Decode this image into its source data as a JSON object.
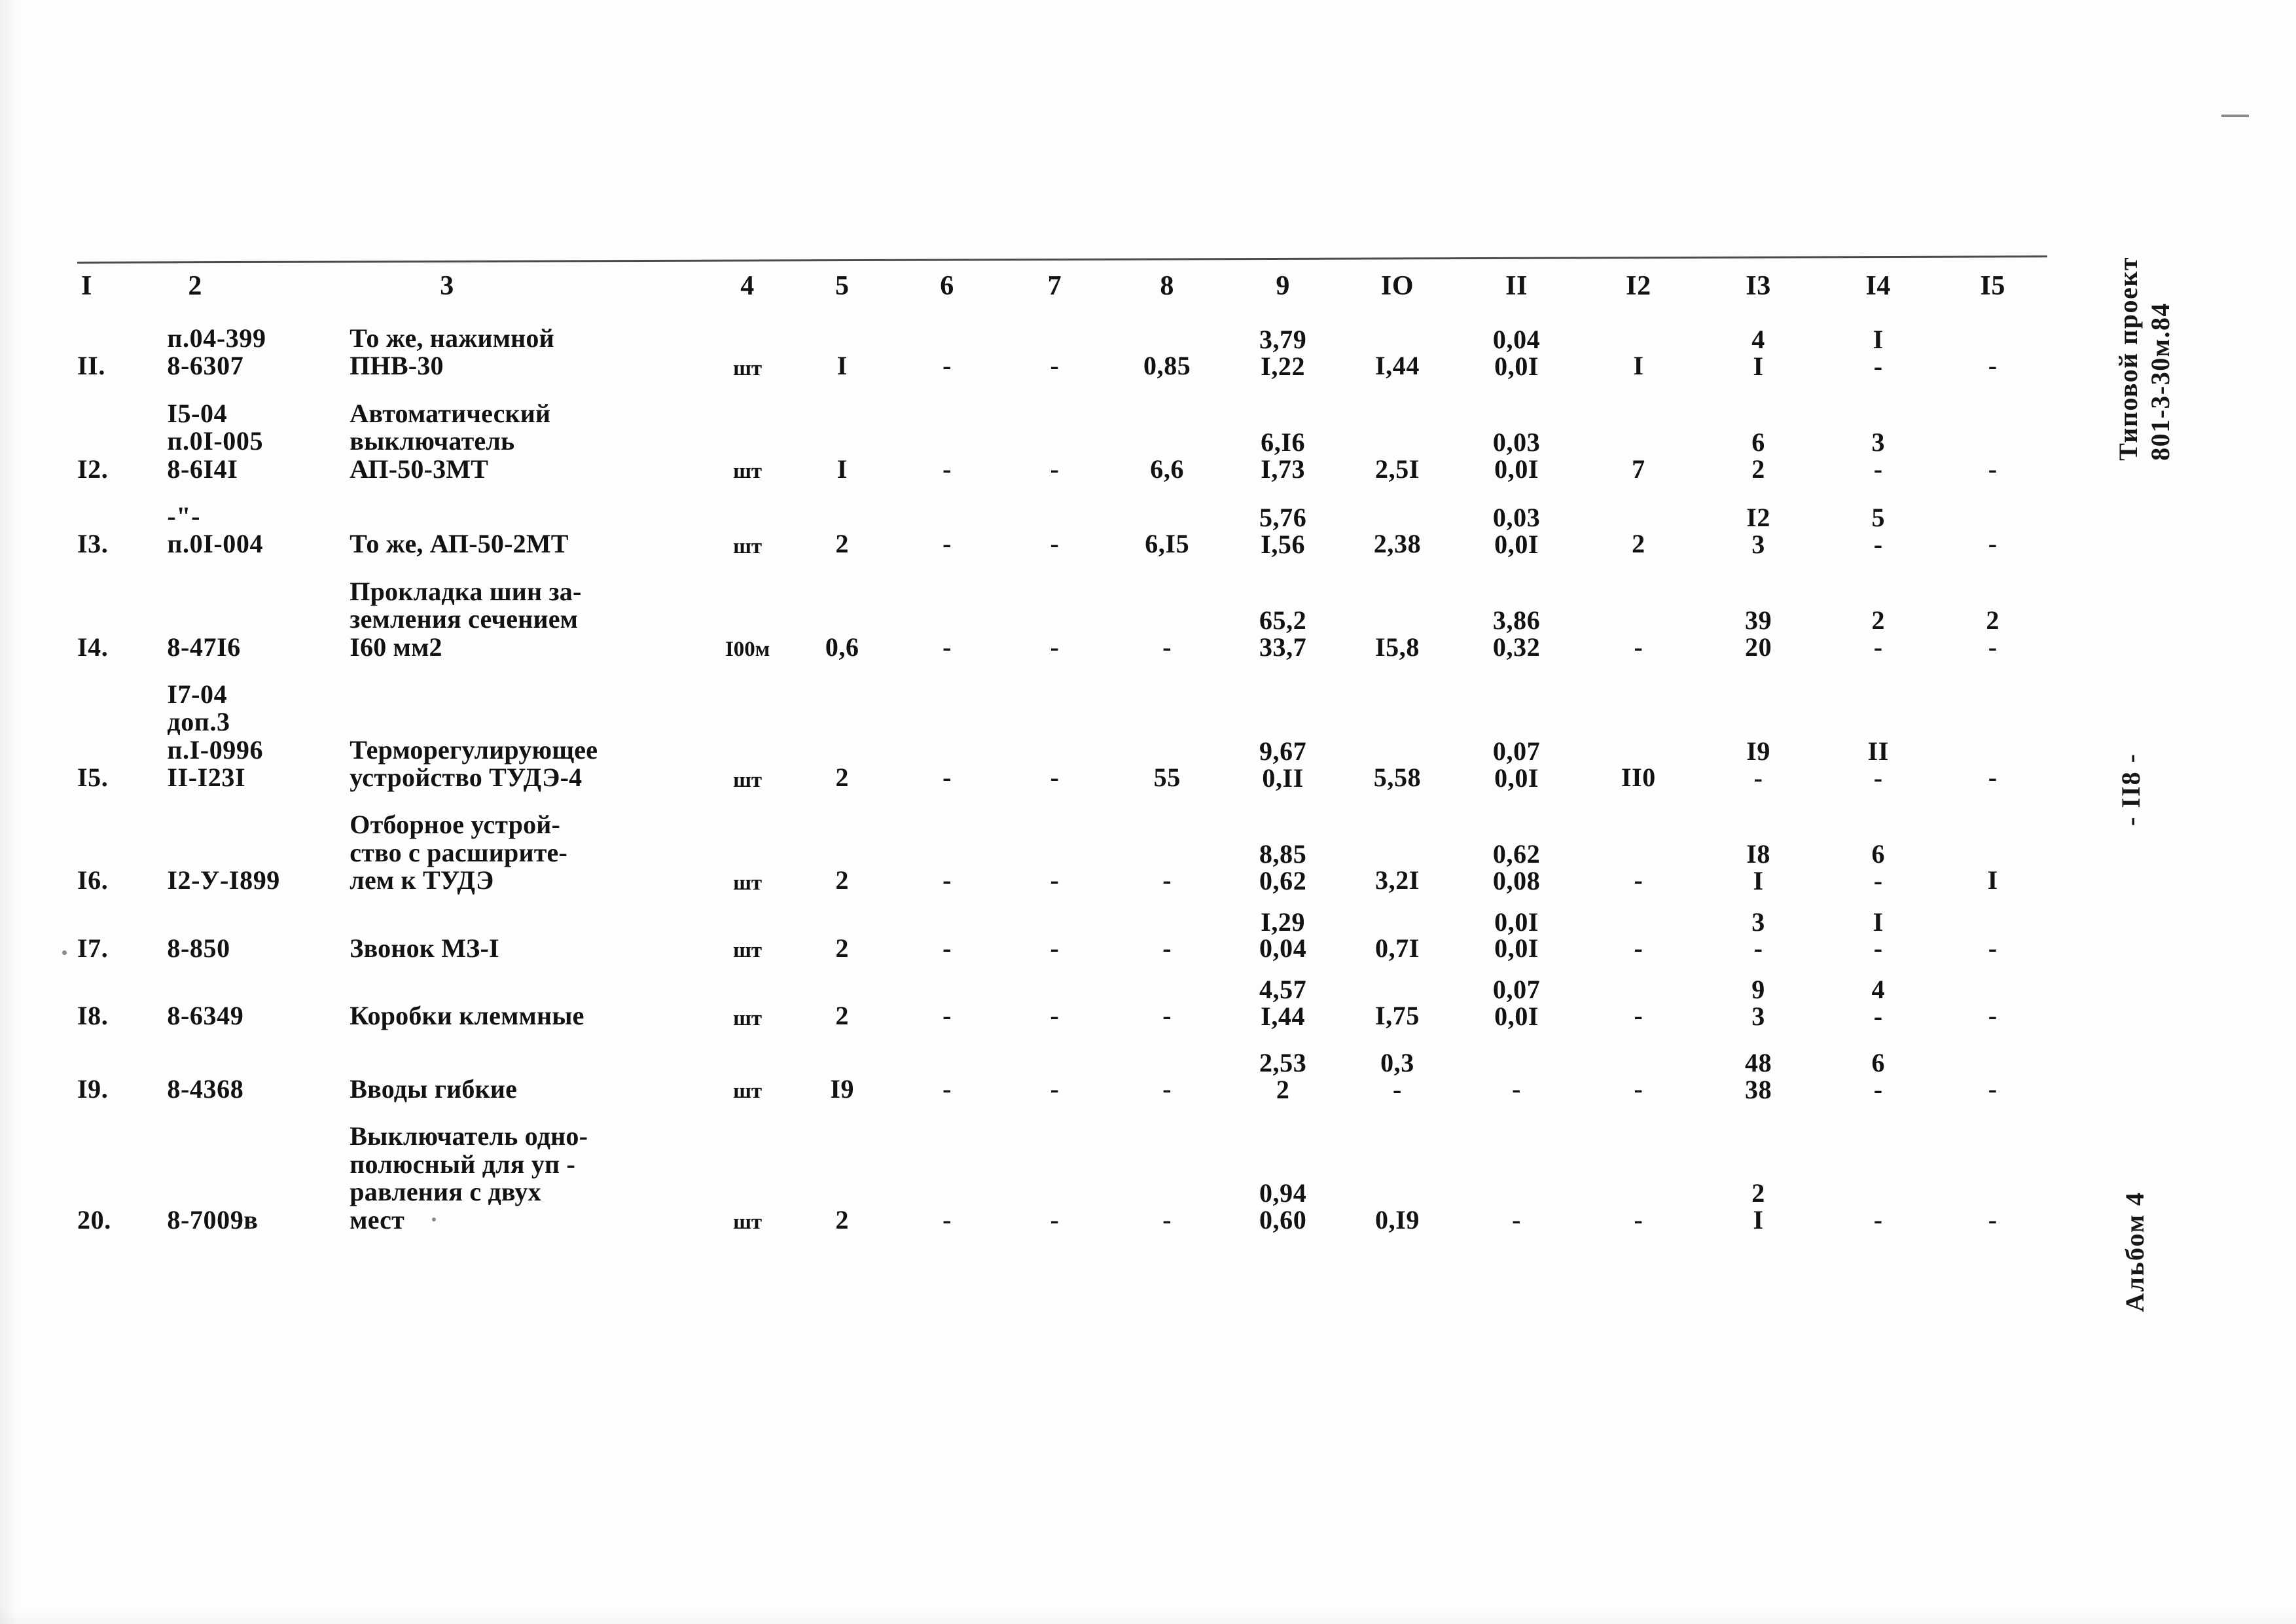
{
  "document": {
    "project_stamp": "Типовой проект\n801-3-30м.84",
    "page_number": "- II8 -",
    "album_label": "Альбом 4"
  },
  "table": {
    "column_headers": [
      "I",
      "2",
      "3",
      "4",
      "5",
      "6",
      "7",
      "8",
      "9",
      "IO",
      "II",
      "I2",
      "I3",
      "I4",
      "I5"
    ],
    "rows": [
      {
        "no": "II.",
        "code": "п.04-399\n8-6307",
        "name": "То же, нажимной\nПНВ-30",
        "unit": "шт",
        "qty": "I",
        "c6": "-",
        "c7": "-",
        "c8": "0,85",
        "c9_top": "3,79",
        "c9_bot": "I,22",
        "c10": "I,44",
        "c11_top": "0,04",
        "c11_bot": "0,0I",
        "c12": "I",
        "c13_top": "4",
        "c13_bot": "I",
        "c14_top": "I",
        "c14_bot": "-",
        "c15": "-"
      },
      {
        "no": "I2.",
        "code": "I5-04\nп.0I-005\n8-6I4I",
        "name": "Автоматический\nвыключатель\nАП-50-3МТ",
        "unit": "шт",
        "qty": "I",
        "c6": "-",
        "c7": "-",
        "c8": "6,6",
        "c9_top": "6,I6",
        "c9_bot": "I,73",
        "c10": "2,5I",
        "c11_top": "0,03",
        "c11_bot": "0,0I",
        "c12": "7",
        "c13_top": "6",
        "c13_bot": "2",
        "c14_top": "3",
        "c14_bot": "-",
        "c15": "-"
      },
      {
        "no": "I3.",
        "code": "-\"-\nп.0I-004",
        "name": "То же, АП-50-2МТ",
        "unit": "шт",
        "qty": "2",
        "c6": "-",
        "c7": "-",
        "c8": "6,I5",
        "c9_top": "5,76",
        "c9_bot": "I,56",
        "c10": "2,38",
        "c11_top": "0,03",
        "c11_bot": "0,0I",
        "c12": "2",
        "c13_top": "I2",
        "c13_bot": "3",
        "c14_top": "5",
        "c14_bot": "-",
        "c15": "-"
      },
      {
        "no": "I4.",
        "code": "8-47I6",
        "name": "Прокладка шин за-\nземления сечением\nI60 мм2",
        "unit": "I00м",
        "qty": "0,6",
        "c6": "-",
        "c7": "-",
        "c8": "-",
        "c9_top": "65,2",
        "c9_bot": "33,7",
        "c10": "I5,8",
        "c11_top": "3,86",
        "c11_bot": "0,32",
        "c12": "-",
        "c13_top": "39",
        "c13_bot": "20",
        "c14_top": "2",
        "c14_bot": "-",
        "c15_top": "2",
        "c15_bot": "-"
      },
      {
        "no": "I5.",
        "code": "I7-04\nдоп.3\nп.I-0996\nII-I23I",
        "name": "Терморегулирующее\nустройство ТУДЭ-4",
        "unit": "шт",
        "qty": "2",
        "c6": "-",
        "c7": "-",
        "c8": "55",
        "c9_top": "9,67",
        "c9_bot": "0,II",
        "c10": "5,58",
        "c11_top": "0,07",
        "c11_bot": "0,0I",
        "c12": "II0",
        "c13_top": "I9",
        "c13_bot": "-",
        "c14_top": "II",
        "c14_bot": "-",
        "c15": "-"
      },
      {
        "no": "I6.",
        "code": "I2-У-I899",
        "name": "Отборное устрой-\nство с расширите-\nлем к ТУДЭ",
        "unit": "шт",
        "qty": "2",
        "c6": "-",
        "c7": "-",
        "c8": "-",
        "c9_top": "8,85",
        "c9_bot": "0,62",
        "c10": "3,2I",
        "c11_top": "0,62",
        "c11_bot": "0,08",
        "c12": "-",
        "c13_top": "I8",
        "c13_bot": "I",
        "c14_top": "6",
        "c14_bot": "-",
        "c15": "I"
      },
      {
        "no": "I7.",
        "code": "8-850",
        "name": "Звонок МЗ-I",
        "unit": "шт",
        "qty": "2",
        "c6": "-",
        "c7": "-",
        "c8": "-",
        "c9_top": "I,29",
        "c9_bot": "0,04",
        "c10": "0,7I",
        "c11_top": "0,0I",
        "c11_bot": "0,0I",
        "c12": "-",
        "c13_top": "3",
        "c13_bot": "-",
        "c14_top": "I",
        "c14_bot": "-",
        "c15": "-"
      },
      {
        "no": "I8.",
        "code": "8-6349",
        "name": "Коробки клеммные",
        "unit": "шт",
        "qty": "2",
        "c6": "-",
        "c7": "-",
        "c8": "-",
        "c9_top": "4,57",
        "c9_bot": "I,44",
        "c10": "I,75",
        "c11_top": "0,07",
        "c11_bot": "0,0I",
        "c12": "-",
        "c13_top": "9",
        "c13_bot": "3",
        "c14_top": "4",
        "c14_bot": "-",
        "c15": "-"
      },
      {
        "no": "I9.",
        "code": "8-4368",
        "name": "Вводы гибкие",
        "unit": "шт",
        "qty": "I9",
        "c6": "-",
        "c7": "-",
        "c8": "-",
        "c9_top": "2,53",
        "c9_bot": "2",
        "c10_top": "0,3",
        "c10_bot": "-",
        "c11": "-",
        "c12": "-",
        "c13_top": "48",
        "c13_bot": "38",
        "c14_top": "6",
        "c14_bot": "-",
        "c15": "-"
      },
      {
        "no": "20.",
        "code": "8-7009в",
        "name": "Выключатель одно-\nполюсный для уп -\nравления с двух\nмест",
        "unit": "шт",
        "qty": "2",
        "c6": "-",
        "c7": "-",
        "c8": "-",
        "c9_top": "0,94",
        "c9_bot": "0,60",
        "c10": "0,I9",
        "c11": "-",
        "c12": "-",
        "c13_top": "2",
        "c13_bot": "I",
        "c14": "-",
        "c15": "-"
      }
    ]
  }
}
